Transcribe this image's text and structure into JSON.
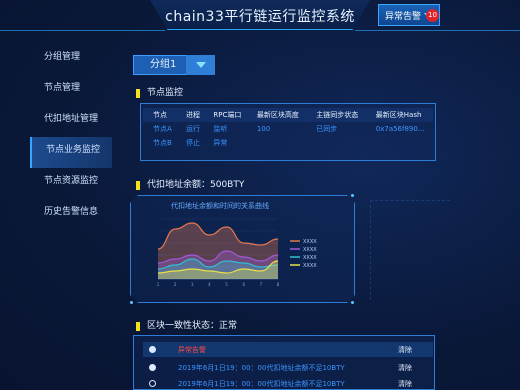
{
  "header": {
    "title": "chain33平行链运行监控系统",
    "alarm_label": "异常告警",
    "alarm_count": "10"
  },
  "sidebar": {
    "items": [
      {
        "label": "分组管理"
      },
      {
        "label": "节点管理"
      },
      {
        "label": "代扣地址管理"
      },
      {
        "label": "节点业务监控"
      },
      {
        "label": "节点资源监控"
      },
      {
        "label": "历史告警信息"
      }
    ],
    "active_index": 3
  },
  "group_select": {
    "value": "分组1"
  },
  "node_monitor": {
    "title": "节点监控",
    "columns": [
      "节点",
      "进程",
      "RPC端口",
      "最新区块高度",
      "主链同步状态",
      "最新区块Hash"
    ],
    "rows": [
      [
        "节点A",
        "运行",
        "监听",
        "100",
        "已同步",
        "0x7a56f890..."
      ],
      [
        "节点B",
        "停止",
        "异常",
        "",
        "",
        ""
      ]
    ]
  },
  "balance": {
    "title": "代扣地址余额：500BTY",
    "chart_subtitle": "代扣地址余额和时间的关系曲线"
  },
  "chart_data": {
    "type": "area",
    "x": [
      "1",
      "2",
      "3",
      "4",
      "5",
      "6",
      "7",
      "8"
    ],
    "series": [
      {
        "name": "XXXX",
        "color": "#e8774f",
        "values": [
          15,
          25,
          28,
          22,
          26,
          18,
          17,
          20
        ]
      },
      {
        "name": "XXXX",
        "color": "#a05bd8",
        "values": [
          8,
          10,
          12,
          9,
          14,
          11,
          9,
          12
        ]
      },
      {
        "name": "XXXX",
        "color": "#2fbfd1",
        "values": [
          5,
          7,
          10,
          6,
          9,
          8,
          6,
          7
        ]
      },
      {
        "name": "XXXX",
        "color": "#e7e24a",
        "values": [
          3,
          4,
          5,
          4,
          3,
          5,
          4,
          9
        ]
      }
    ],
    "ylim": [
      0,
      30
    ],
    "grid": true,
    "legend": "right"
  },
  "consistency": {
    "title": "区块一致性状态：正常"
  },
  "alarms": {
    "rows": [
      {
        "text": "异常告警",
        "op": "清除"
      },
      {
        "text": "2019年6月1日19：00：00代扣地址余额不足10BTY",
        "op": "清除"
      },
      {
        "text": "2019年6月1日19：00：00代扣地址余额不足10BTY",
        "op": "清除"
      }
    ]
  }
}
